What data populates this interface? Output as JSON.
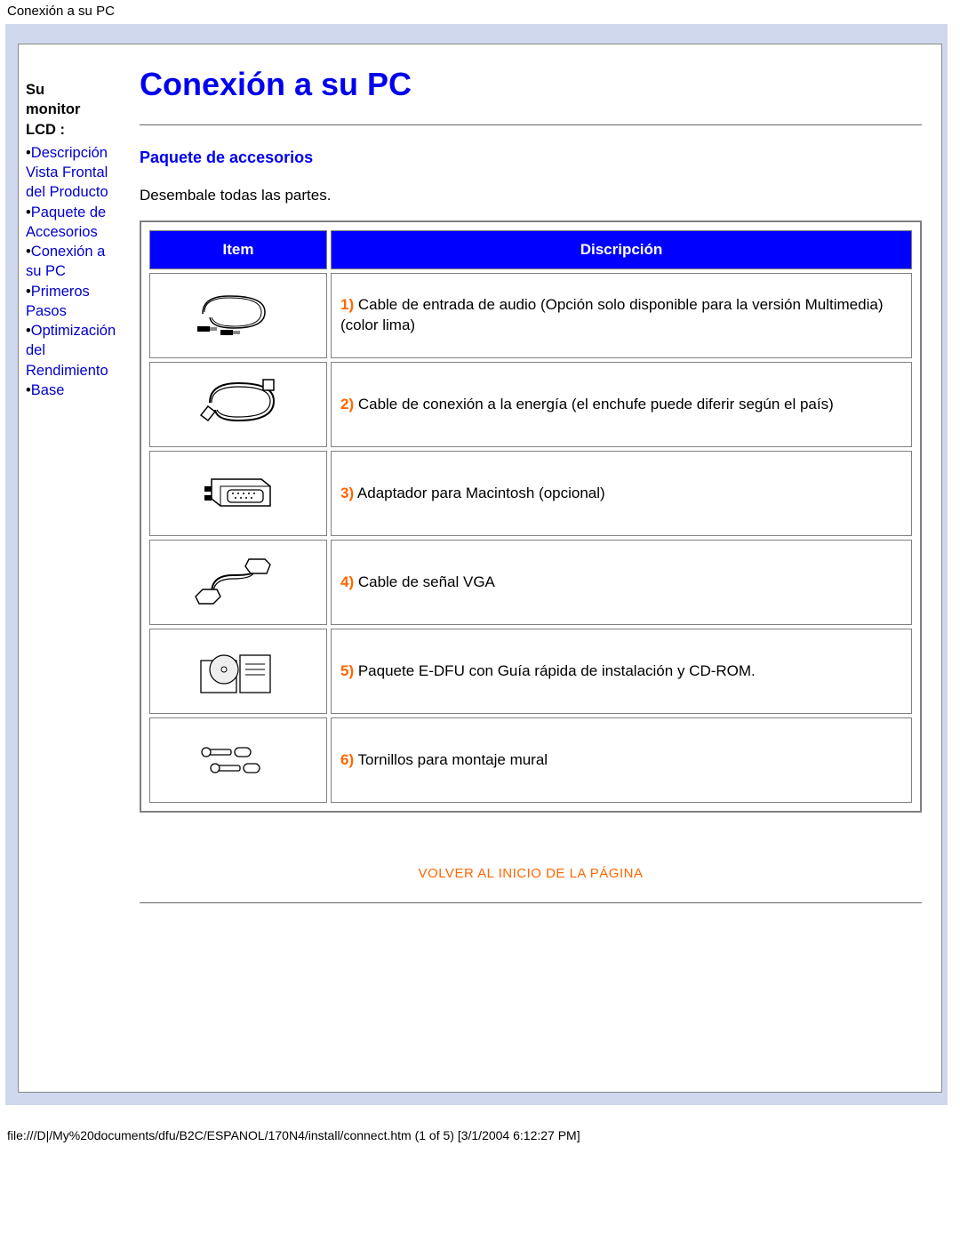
{
  "header_text": "Conexión a su PC",
  "sidebar": {
    "title_line1": "Su",
    "title_line2": "monitor",
    "title_line3": "LCD",
    "colon": " : ",
    "items": [
      {
        "label": "Descripción Vista Frontal del Producto"
      },
      {
        "label": "Paquete de Accesorios"
      },
      {
        "label": "Conexión a su PC"
      },
      {
        "label": "Primeros Pasos"
      },
      {
        "label": "Optimización del Rendimiento"
      },
      {
        "label": "Base"
      }
    ]
  },
  "main": {
    "title": "Conexión a su PC",
    "section_heading": "Paquete de accesorios",
    "intro": "Desembale todas las partes.",
    "table": {
      "col_item": "Item",
      "col_desc": "Discripción",
      "rows": [
        {
          "num": "1)",
          "desc": " Cable de entrada de audio (Opción solo disponible para la versión Multimedia)(color lima)"
        },
        {
          "num": "2)",
          "desc": " Cable de conexión a la energía (el enchufe puede diferir según el país)"
        },
        {
          "num": "3)",
          "desc": " Adaptador para Macintosh (opcional)"
        },
        {
          "num": "4)",
          "desc": " Cable de señal VGA"
        },
        {
          "num": "5)",
          "desc": " Paquete E-DFU con Guía rápida de instalación y CD-ROM."
        },
        {
          "num": "6)",
          "desc": " Tornillos para montaje mural"
        }
      ]
    },
    "back_to_top": "VOLVER AL INICIO DE LA PÁGINA"
  },
  "footer": "file:///D|/My%20documents/dfu/B2C/ESPANOL/170N4/install/connect.htm (1 of 5) [3/1/2004 6:12:27 PM]"
}
